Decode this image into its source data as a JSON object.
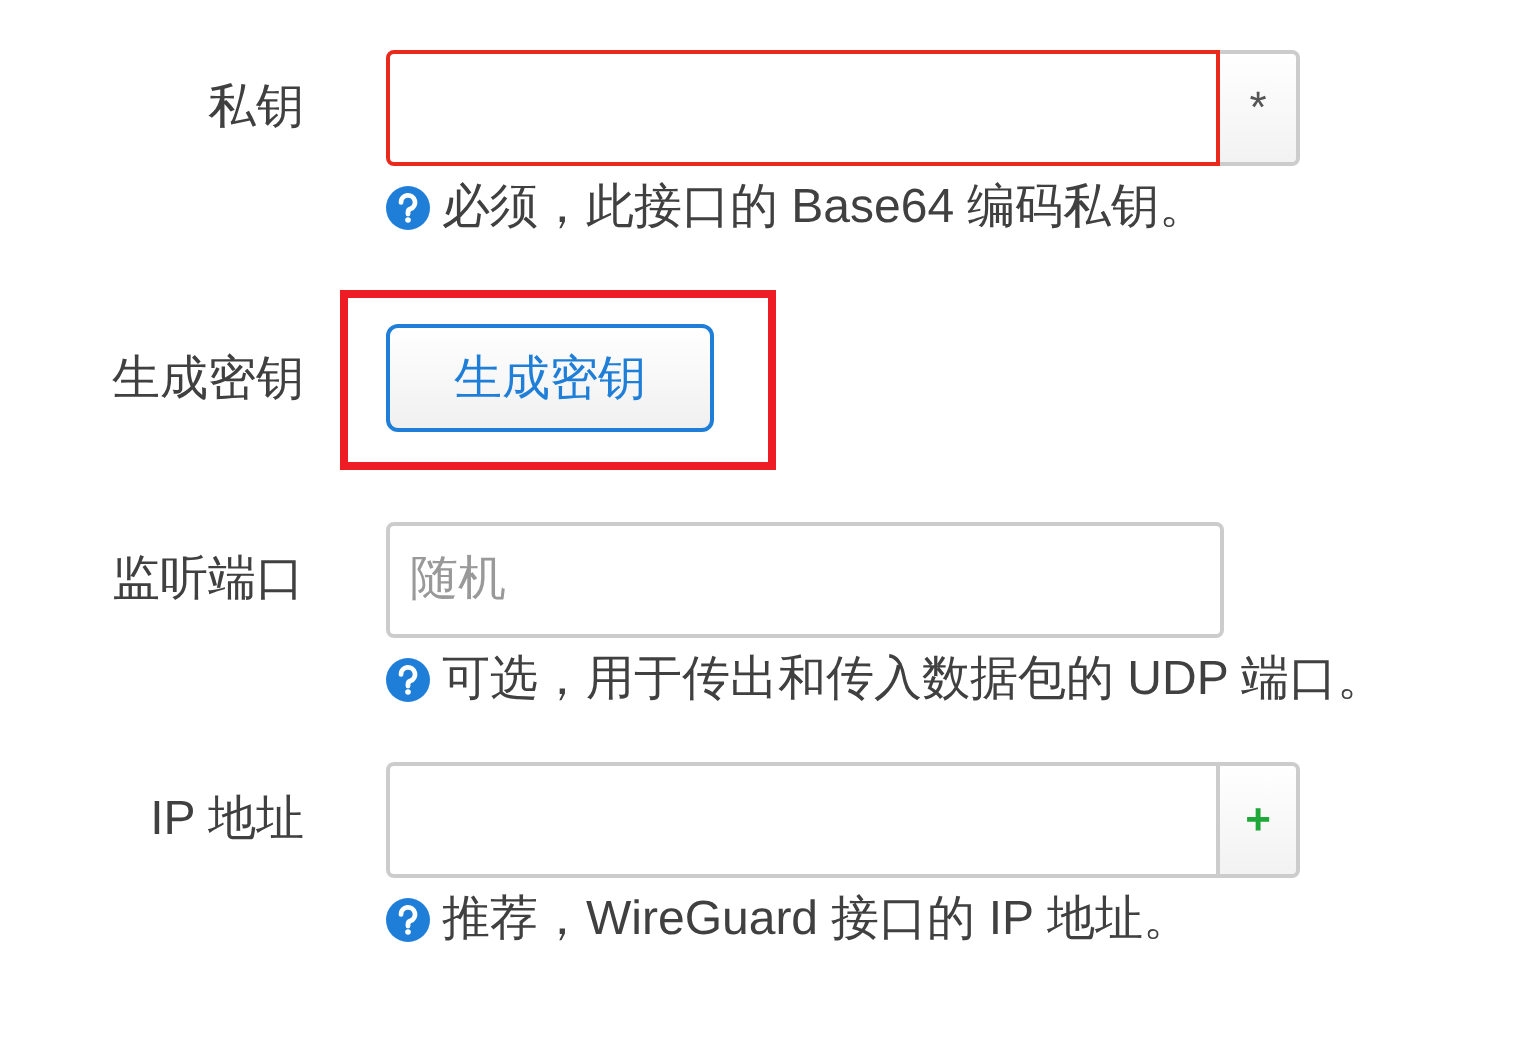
{
  "fields": [
    {
      "kind": "input",
      "label": "私钥",
      "invalid": true,
      "addon": {
        "kind": "required",
        "text": "*"
      },
      "help": "必须，此接口的 Base64 编码私钥。"
    },
    {
      "kind": "button",
      "label": "生成密钥",
      "button": "生成密钥",
      "highlighted": true
    },
    {
      "kind": "input",
      "label": "监听端口",
      "invalid": false,
      "placeholder": "随机",
      "help": "可选，用于传出和传入数据包的 UDP 端口。"
    },
    {
      "kind": "input",
      "label": "IP 地址",
      "invalid": false,
      "addon": {
        "kind": "add",
        "text": "+"
      },
      "help": "推荐，WireGuard 接口的 IP 地址。"
    }
  ]
}
